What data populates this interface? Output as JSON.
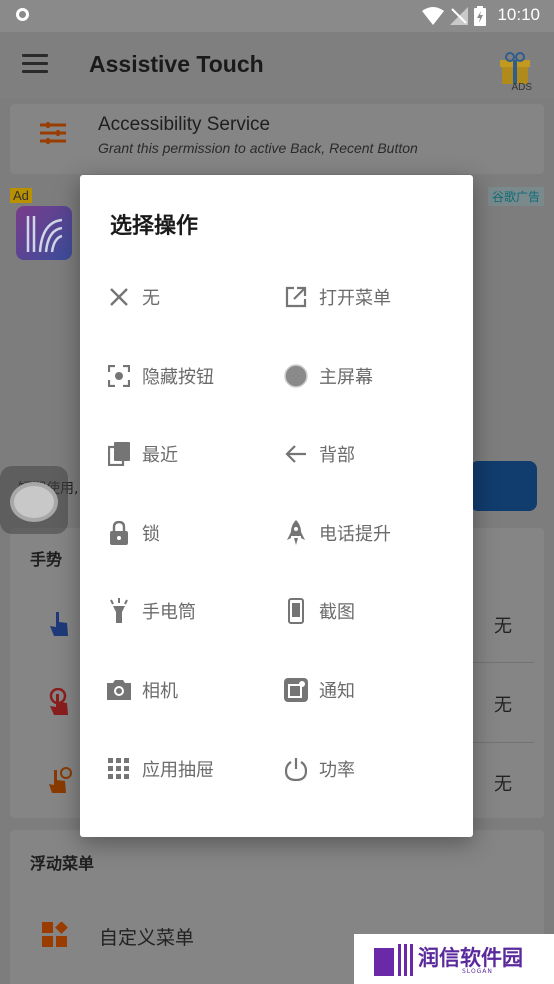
{
  "status_bar": {
    "time": "10:10"
  },
  "app_bar": {
    "title": "Assistive Touch",
    "ads_label": "ADS"
  },
  "accessibility": {
    "title": "Accessibility Service",
    "subtitle": "Grant this permission to active Back, Recent Button"
  },
  "ad": {
    "badge": "Ad",
    "google_label": "谷歌广告",
    "text_fragment": "短期使用,"
  },
  "gesture": {
    "title": "手势",
    "values": [
      "无",
      "无",
      "无"
    ]
  },
  "floating_menu": {
    "title": "浮动菜单",
    "item": "自定义菜单"
  },
  "dialog": {
    "title": "选择操作",
    "options": [
      {
        "label": "无",
        "icon": "close-icon"
      },
      {
        "label": "打开菜单",
        "icon": "open-in-new-icon"
      },
      {
        "label": "隐藏按钮",
        "icon": "hide-focus-icon"
      },
      {
        "label": "主屏幕",
        "icon": "home-circle-icon"
      },
      {
        "label": "最近",
        "icon": "recents-icon"
      },
      {
        "label": "背部",
        "icon": "back-arrow-icon"
      },
      {
        "label": "锁",
        "icon": "lock-icon"
      },
      {
        "label": "电话提升",
        "icon": "rocket-icon"
      },
      {
        "label": "手电筒",
        "icon": "flashlight-icon"
      },
      {
        "label": "截图",
        "icon": "screenshot-phone-icon"
      },
      {
        "label": "相机",
        "icon": "camera-icon"
      },
      {
        "label": "通知",
        "icon": "notification-icon"
      },
      {
        "label": "应用抽屉",
        "icon": "app-drawer-icon"
      },
      {
        "label": "功率",
        "icon": "power-icon"
      }
    ]
  },
  "watermark": {
    "text": "润信软件园",
    "slogan": "SLOGAN"
  }
}
